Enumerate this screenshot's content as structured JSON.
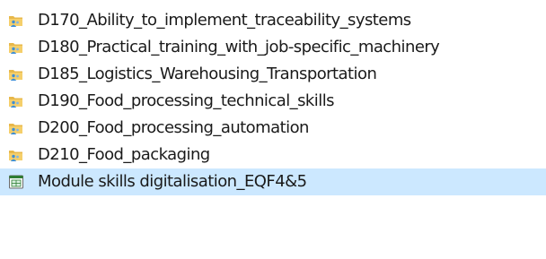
{
  "files": [
    {
      "name": "D170_Ability_to_implement_traceability_systems",
      "icon": "shared-folder-icon"
    },
    {
      "name": "D180_Practical_training_with_job-specific_machinery",
      "icon": "shared-folder-icon"
    },
    {
      "name": "D185_Logistics_Warehousing_Transportation",
      "icon": "shared-folder-icon"
    },
    {
      "name": "D190_Food_processing_technical_skills",
      "icon": "shared-folder-icon"
    },
    {
      "name": "D200_Food_processing_automation",
      "icon": "shared-folder-icon"
    },
    {
      "name": "D210_Food_packaging",
      "icon": "shared-folder-icon"
    },
    {
      "name": "Module skills digitalisation_EQF4&5",
      "icon": "spreadsheet-icon"
    }
  ],
  "selected_index": 6,
  "colors": {
    "folder_top": "#e8b84a",
    "folder_body": "#f5cf6b",
    "people_badge": "#3f8fd6",
    "selection": "#cce8ff",
    "sheet_green": "#2e7d32"
  }
}
